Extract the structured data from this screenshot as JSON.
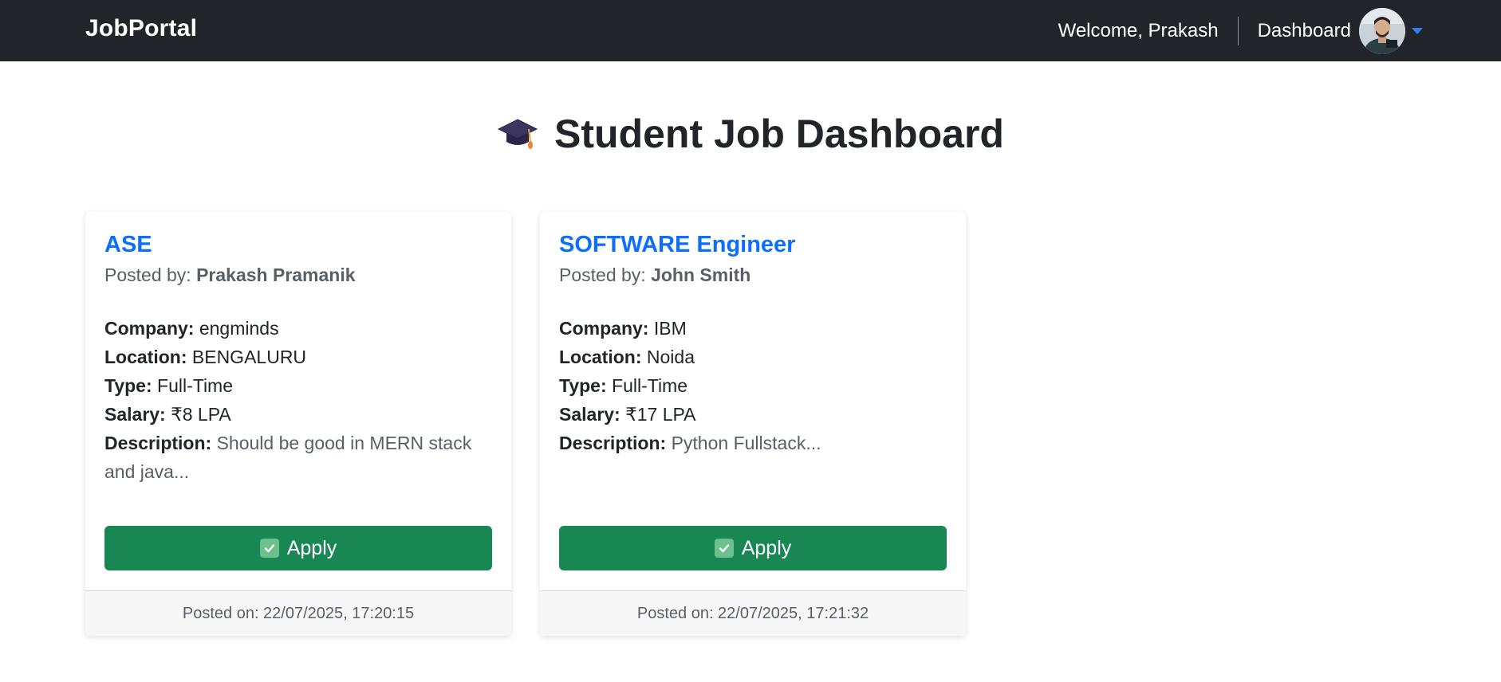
{
  "navbar": {
    "brand": "JobPortal",
    "welcome": "Welcome, Prakash",
    "dashboard": "Dashboard"
  },
  "page": {
    "title": "Student Job Dashboard"
  },
  "labels": {
    "posted_by": "Posted by:",
    "company": "Company:",
    "location": "Location:",
    "type": "Type:",
    "salary": "Salary:",
    "description": "Description:",
    "apply": "Apply"
  },
  "jobs": [
    {
      "title": "ASE",
      "posted_by": "Prakash Pramanik",
      "company": "engminds",
      "location": "BENGALURU",
      "type": "Full-Time",
      "salary": "₹8 LPA",
      "description": "Should be good in MERN stack and java...",
      "posted_on": "Posted on: 22/07/2025, 17:20:15"
    },
    {
      "title": "SOFTWARE Engineer",
      "posted_by": "John Smith",
      "company": "IBM",
      "location": "Noida",
      "type": "Full-Time",
      "salary": "₹17 LPA",
      "description": "Python Fullstack...",
      "posted_on": "Posted on: 22/07/2025, 17:21:32"
    }
  ],
  "icons": {
    "title_icon": "graduation-cap-icon",
    "apply_icon": "check-mark-button-icon",
    "dropdown_icon": "caret-down-icon"
  },
  "colors": {
    "navbar_bg": "#212529",
    "link_blue": "#0d6efd",
    "apply_green": "#198754"
  }
}
